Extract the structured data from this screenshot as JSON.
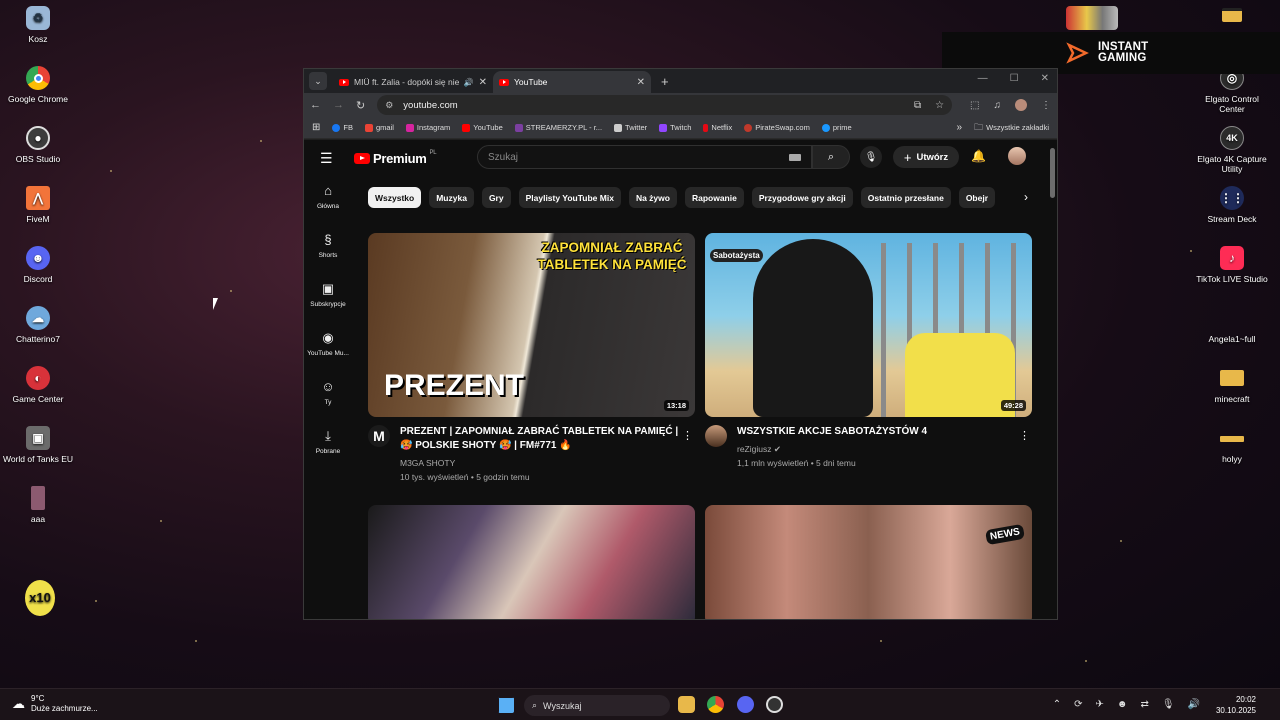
{
  "desktop": {
    "left_icons": [
      {
        "label": "Kosz",
        "icon": "recycle-bin-icon",
        "color": "#9ab7d6"
      },
      {
        "label": "Google Chrome",
        "icon": "chrome-icon",
        "color": "#e84335"
      },
      {
        "label": "OBS Studio",
        "icon": "obs-icon",
        "color": "#444444"
      },
      {
        "label": "FiveM",
        "icon": "fivem-icon",
        "color": "#f2743a"
      },
      {
        "label": "Discord",
        "icon": "discord-icon",
        "color": "#5865f2"
      },
      {
        "label": "Chatterino7",
        "icon": "chatterino-icon",
        "color": "#6fa8dc"
      },
      {
        "label": "Game Center",
        "icon": "game-center-icon",
        "color": "#d8323a"
      },
      {
        "label": "World of Tanks EU",
        "icon": "wot-icon",
        "color": "#6b6b6b"
      },
      {
        "label": "aaa",
        "icon": "aaa-icon",
        "color": "#8c5a70"
      }
    ],
    "x10_label": "x10",
    "right_icons": [
      {
        "label": "Elgato Control Center",
        "icon": "elgato-cc-icon",
        "color": "#2b2b2b"
      },
      {
        "label": "Elgato 4K Capture Utility",
        "icon": "elgato-4k-icon",
        "color": "#2b2b2b"
      },
      {
        "label": "Stream Deck",
        "icon": "stream-deck-icon",
        "color": "#1e2a5a"
      },
      {
        "label": "TikTok LIVE Studio",
        "icon": "tiktok-icon",
        "color": "#fe2c55"
      },
      {
        "label": "Angela1~full",
        "icon": "file-icon",
        "color": "#2c2228"
      },
      {
        "label": "minecraft",
        "icon": "folder-icon",
        "color": "#e8b84a"
      },
      {
        "label": "holyy",
        "icon": "folder-icon",
        "color": "#e8b84a"
      }
    ]
  },
  "instant_gaming": {
    "line1": "INSTANT",
    "line2": "GAMING"
  },
  "browser": {
    "tabs": [
      {
        "title": "MIÜ ft. Zalia - dopóki się nie...",
        "active": false
      },
      {
        "title": "YouTube",
        "active": true
      }
    ],
    "url": "youtube.com",
    "bookmarks": [
      {
        "label": "FB",
        "color": "#1877f2"
      },
      {
        "label": "gmail",
        "color": "#ea4335"
      },
      {
        "label": "Instagram",
        "color": "#d6249f"
      },
      {
        "label": "YouTube",
        "color": "#ff0000"
      },
      {
        "label": "STREAMERZY.PL - r...",
        "color": "#7b3fa0"
      },
      {
        "label": "Twitter",
        "color": "#cccccc"
      },
      {
        "label": "Twitch",
        "color": "#9146ff"
      },
      {
        "label": "Netflix",
        "color": "#e50914"
      },
      {
        "label": "PirateSwap.com",
        "color": "#c0392b"
      },
      {
        "label": "prime",
        "color": "#1a98ff"
      }
    ],
    "all_bookmarks": "Wszystkie zakładki"
  },
  "youtube": {
    "logo_text": "Premium",
    "logo_region": "PL",
    "search_placeholder": "Szukaj",
    "create_label": "Utwórz",
    "sidebar": [
      {
        "label": "Główna",
        "icon": "home-icon",
        "glyph": "⌂"
      },
      {
        "label": "Shorts",
        "icon": "shorts-icon",
        "glyph": "⟳"
      },
      {
        "label": "Subskrypcje",
        "icon": "subscriptions-icon",
        "glyph": "▶"
      },
      {
        "label": "YouTube Mu...",
        "icon": "youtube-music-icon",
        "glyph": "◉"
      },
      {
        "label": "Ty",
        "icon": "you-icon",
        "glyph": "☺"
      },
      {
        "label": "Pobrane",
        "icon": "downloads-icon",
        "glyph": "⤓"
      }
    ],
    "chips": [
      "Wszystko",
      "Muzyka",
      "Gry",
      "Playlisty YouTube Mix",
      "Na żywo",
      "Rapowanie",
      "Przygodowe gry akcji",
      "Ostatnio przesłane",
      "Obejr"
    ],
    "videos": [
      {
        "title": "PREZENT | ZAPOMNIAŁ ZABRAĆ TABLETEK NA PAMIĘĆ | 🥵 POLSKIE SHOTY 🥵 | FM#771 🔥",
        "channel": "M3GA SHOTY",
        "stats": "10 tys. wyświetleń • 5 godzin temu",
        "duration": "13:18",
        "overlay_top": "ZAPOMNIAŁ ZABRAĆ TABLETEK NA PAMIĘĆ",
        "overlay_bottom": "PREZENT"
      },
      {
        "title": "WSZYSTKIE AKCJE SABOTAŻYSTÓW 4",
        "channel": "reZigiusz ✔",
        "stats": "1,1 mln wyświetleń • 5 dni temu",
        "duration": "49:28",
        "overlay_top": "Sabotażysta",
        "overlay_bottom": ""
      },
      {
        "title": "",
        "channel": "",
        "stats": "",
        "duration": "",
        "overlay_top": "",
        "overlay_bottom": ""
      },
      {
        "title": "",
        "channel": "",
        "stats": "",
        "duration": "",
        "overlay_top": "NEWS",
        "overlay_bottom": ""
      }
    ]
  },
  "taskbar": {
    "weather_temp": "9°C",
    "weather_desc": "Duże zachmurze...",
    "search_label": "Wyszukaj",
    "time": "20:02",
    "date": "30.10.2025"
  }
}
